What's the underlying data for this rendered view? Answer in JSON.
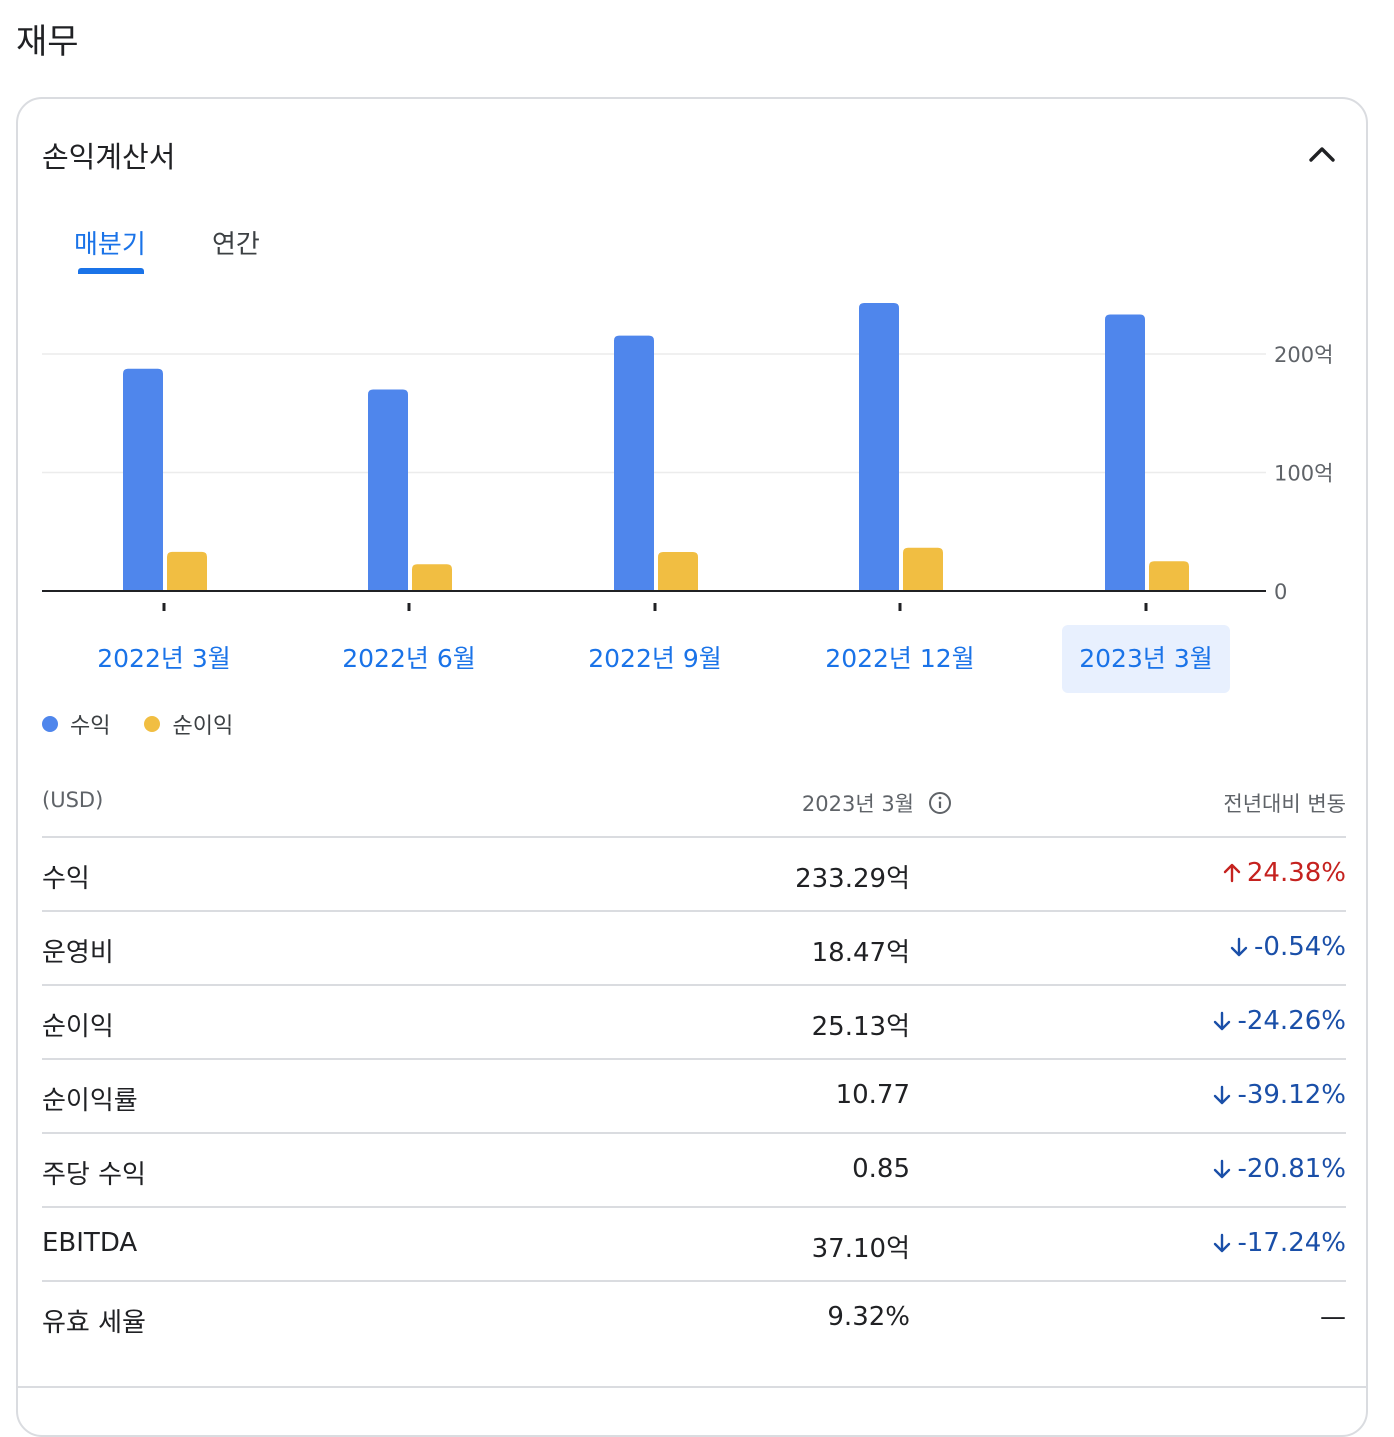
{
  "page": {
    "title": "재무"
  },
  "card": {
    "title": "손익계산서",
    "tabs": [
      {
        "label": "매분기",
        "selected": true
      },
      {
        "label": "연간",
        "selected": false
      }
    ]
  },
  "chart_data": {
    "type": "bar",
    "categories": [
      "2022년 3월",
      "2022년 6월",
      "2022년 9월",
      "2022년 12월",
      "2023년 3월"
    ],
    "selected_category": "2023년 3월",
    "series": [
      {
        "name": "수익",
        "values": [
          187.6,
          170.0,
          215.5,
          243.0,
          233.29
        ],
        "color": "#4f86ec"
      },
      {
        "name": "순이익",
        "values": [
          33.0,
          22.6,
          32.9,
          36.5,
          25.13
        ],
        "color": "#f1be42"
      }
    ],
    "y_ticks": [
      {
        "value": 0,
        "label": "0"
      },
      {
        "value": 100,
        "label": "100억"
      },
      {
        "value": 200,
        "label": "200억"
      }
    ],
    "ylim": [
      0,
      250
    ],
    "grid": true,
    "legend_position": "bottom-left"
  },
  "table": {
    "header": {
      "currency": "(USD)",
      "period": "2023년 3월",
      "change": "전년대비 변동"
    },
    "rows": [
      {
        "label": "수익",
        "value": "233.29억",
        "change": "24.38%",
        "direction": "up"
      },
      {
        "label": "운영비",
        "value": "18.47억",
        "change": "-0.54%",
        "direction": "down"
      },
      {
        "label": "순이익",
        "value": "25.13억",
        "change": "-24.26%",
        "direction": "down"
      },
      {
        "label": "순이익률",
        "value": "10.77",
        "change": "-39.12%",
        "direction": "down"
      },
      {
        "label": "주당 수익",
        "value": "0.85",
        "change": "-20.81%",
        "direction": "down"
      },
      {
        "label": "EBITDA",
        "value": "37.10억",
        "change": "-17.24%",
        "direction": "down"
      },
      {
        "label": "유효 세율",
        "value": "9.32%",
        "change": "—",
        "direction": "flat"
      }
    ]
  },
  "colors": {
    "accent": "#1a73e8",
    "up": "#c5221f",
    "down": "#1a4fa8",
    "divider": "#dadce0"
  },
  "icons": {
    "collapse": "chevron-up-icon",
    "info": "info-icon",
    "up": "arrow-up-icon",
    "down": "arrow-down-icon"
  }
}
